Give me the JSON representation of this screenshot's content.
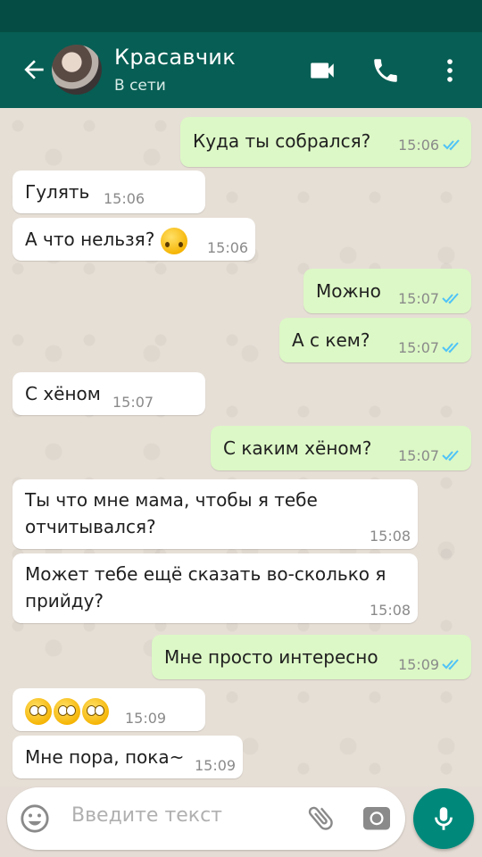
{
  "header": {
    "contact_name": "Красавчик",
    "status": "В сети"
  },
  "input": {
    "placeholder": "Введите текст"
  },
  "colors": {
    "header": "#075e54",
    "status_bar": "#054d44",
    "incoming_bubble": "#ffffff",
    "outgoing_bubble": "#dcf8c6",
    "read_ticks": "#4fc3f7",
    "mic_button": "#00897b"
  },
  "messages": [
    {
      "text": "Куда ты собрался?",
      "time": "15:06",
      "direction": "outgoing",
      "read": true
    },
    {
      "text": "Гулять",
      "time": "15:06",
      "direction": "incoming"
    },
    {
      "text": "А что нельзя?",
      "emoji": [
        "upside-down-face"
      ],
      "time": "15:06",
      "direction": "incoming"
    },
    {
      "text": "Можно",
      "time": "15:07",
      "direction": "outgoing",
      "read": true
    },
    {
      "text": "А с кем?",
      "time": "15:07",
      "direction": "outgoing",
      "read": true
    },
    {
      "text": "С хёном",
      "time": "15:07",
      "direction": "incoming"
    },
    {
      "text": "С каким хёном?",
      "time": "15:07",
      "direction": "outgoing",
      "read": true
    },
    {
      "text": "Ты что мне мама, чтобы я тебе отчитывался?",
      "time": "15:08",
      "direction": "incoming"
    },
    {
      "text": "Может тебе ещё сказать во-сколько я прийду?",
      "time": "15:08",
      "direction": "incoming"
    },
    {
      "text": "Мне просто интересно",
      "time": "15:09",
      "direction": "outgoing",
      "read": true
    },
    {
      "text": "",
      "emoji": [
        "rolling-eyes",
        "rolling-eyes",
        "rolling-eyes"
      ],
      "time": "15:09",
      "direction": "incoming"
    },
    {
      "text": "Мне пора, пока~",
      "time": "15:09",
      "direction": "incoming"
    }
  ],
  "icons": [
    "back-arrow-icon",
    "video-call-icon",
    "phone-icon",
    "more-icon",
    "emoji-icon",
    "attach-icon",
    "camera-icon",
    "mic-icon"
  ]
}
